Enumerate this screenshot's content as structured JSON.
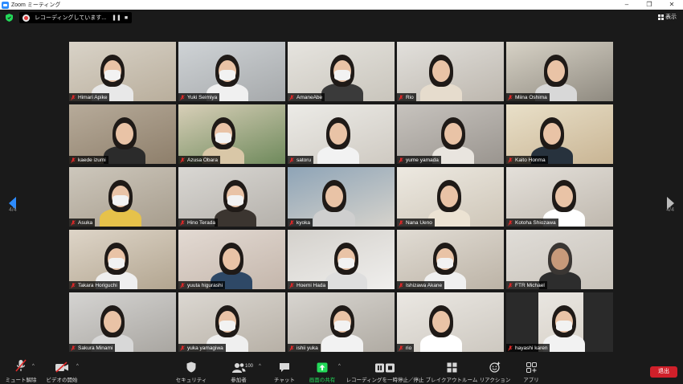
{
  "window": {
    "title": "Zoom ミーティング",
    "minimize": "–",
    "restore": "❐",
    "close": "✕"
  },
  "recording": {
    "status": "レコーディングしています...",
    "pause": "❚❚",
    "stop": "■"
  },
  "view": {
    "label": "表示"
  },
  "paging": {
    "left": "4/4",
    "right": "4/4"
  },
  "participants": [
    "Himari Apike",
    "Yuki Seimiya",
    "AmaneAbe",
    "Rio",
    "Miina Oshima",
    "kaede izumi",
    "Azusa Obara",
    "satoru",
    "yume yamada",
    "Kaito Honma",
    "Asuka",
    "Hino Terada",
    "kyoka",
    "Nana Ueno",
    "Kotoha Shiozawa",
    "Takara Horiguchi",
    "yuuta higurashi",
    "Hoemi Hada",
    "Ishizawa Akane",
    "FTR Michael",
    "Sakura Minami",
    "yuka yamagiwa",
    "ishii yuka",
    "rio",
    "hayashi karen"
  ],
  "toolbar": {
    "unmute": "ミュート解除",
    "start_video": "ビデオの開始",
    "security": "セキュリティ",
    "participants": "参加者",
    "participant_count": "100",
    "chat": "チャット",
    "share": "画面の共有",
    "pause_recording": "レコーディングを一時停止／停止",
    "breakout": "ブレイクアウトルーム",
    "reactions": "リアクション",
    "apps": "アプリ",
    "leave": "退出"
  },
  "colors": {
    "accent_green": "#23d959",
    "leave_red": "#d0202a",
    "muted_red": "#e02828",
    "zoom_blue": "#2d8cff",
    "page_arrow": "#2d8cff"
  }
}
